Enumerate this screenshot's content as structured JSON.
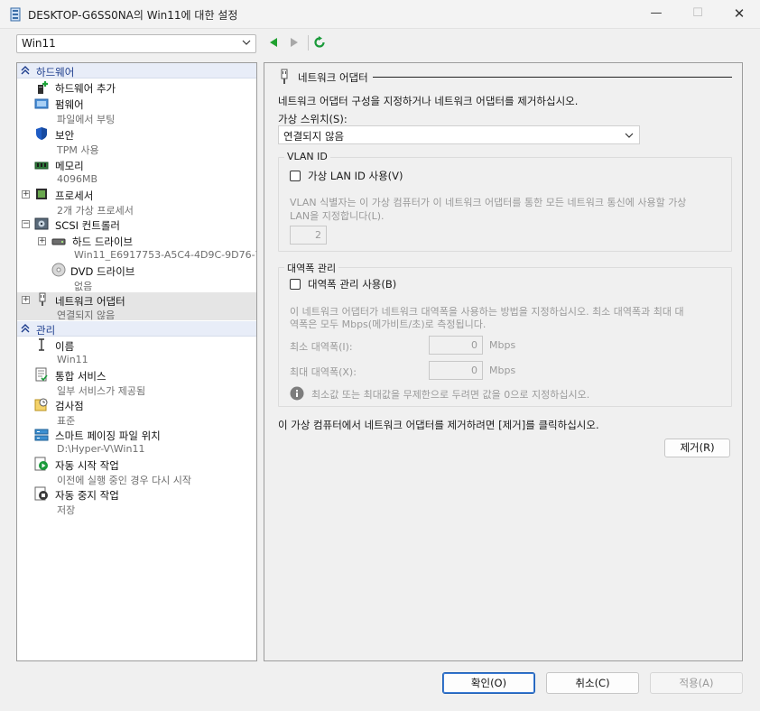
{
  "window": {
    "title": "DESKTOP-G6SS0NA의 Win11에 대한 설정",
    "minimize": "—",
    "maximize": "☐",
    "close": "✕"
  },
  "vm_selector": {
    "value": "Win11"
  },
  "sidebar": {
    "hardware_header": "하드웨어",
    "management_header": "관리",
    "hardware_items": [
      {
        "name": "하드웨어 추가",
        "sub": ""
      },
      {
        "name": "펌웨어",
        "sub": "파일에서 부팅"
      },
      {
        "name": "보안",
        "sub": "TPM 사용"
      },
      {
        "name": "메모리",
        "sub": "4096MB"
      },
      {
        "name": "프로세서",
        "sub": "2개 가상 프로세서"
      },
      {
        "name": "SCSI 컨트롤러",
        "sub": ""
      },
      {
        "name": "하드 드라이브",
        "sub": "Win11_E6917753-A5C4-4D9C-9D76-7..."
      },
      {
        "name": "DVD 드라이브",
        "sub": "없음"
      },
      {
        "name": "네트워크 어댑터",
        "sub": "연결되지 않음"
      }
    ],
    "management_items": [
      {
        "name": "이름",
        "sub": "Win11"
      },
      {
        "name": "통합 서비스",
        "sub": "일부 서비스가 제공됨"
      },
      {
        "name": "검사점",
        "sub": "표준"
      },
      {
        "name": "스마트 페이징 파일 위치",
        "sub": "D:\\Hyper-V\\Win11"
      },
      {
        "name": "자동 시작 작업",
        "sub": "이전에 실행 중인 경우 다시 시작"
      },
      {
        "name": "자동 중지 작업",
        "sub": "저장"
      }
    ],
    "expanders": {
      "plus": "+",
      "minus": "−"
    }
  },
  "panel": {
    "title": "네트워크 어댑터",
    "description": "네트워크 어댑터 구성을 지정하거나 네트워크 어댑터를 제거하십시오.",
    "switch_label": "가상 스위치(S):",
    "switch_value": "연결되지 않음",
    "vlan": {
      "legend": "VLAN ID",
      "checkbox_label": "가상 LAN ID 사용(V)",
      "help_line1": "VLAN 식별자는 이 가상 컴퓨터가 이 네트워크 어댑터를 통한 모든 네트워크 통신에 사용할 가상",
      "help_line2": "LAN을 지정합니다(L).",
      "value": "2"
    },
    "bandwidth": {
      "legend": "대역폭 관리",
      "checkbox_label": "대역폭 관리 사용(B)",
      "help_line1": "이 네트워크 어댑터가 네트워크 대역폭을 사용하는 방법을 지정하십시오. 최소 대역폭과 최대 대",
      "help_line2": "역폭은 모두 Mbps(메가비트/초)로 측정됩니다.",
      "min_label": "최소 대역폭(I):",
      "min_value": "0",
      "max_label": "최대 대역폭(X):",
      "max_value": "0",
      "unit": "Mbps",
      "info": "최소값 또는 최대값을 무제한으로 두려면 값을 0으로 지정하십시오."
    },
    "remove_hint": "이 가상 컴퓨터에서 네트워크 어댑터를 제거하려면 [제거]를 클릭하십시오.",
    "remove_button": "제거(R)"
  },
  "footer": {
    "ok": "확인(O)",
    "cancel": "취소(C)",
    "apply": "적용(A)"
  },
  "colors": {
    "section_header_text": "#1c3c8c",
    "refresh_green": "#1a9a3a",
    "nav_green": "#1fa12f",
    "primary_border": "#1e5fb4"
  }
}
